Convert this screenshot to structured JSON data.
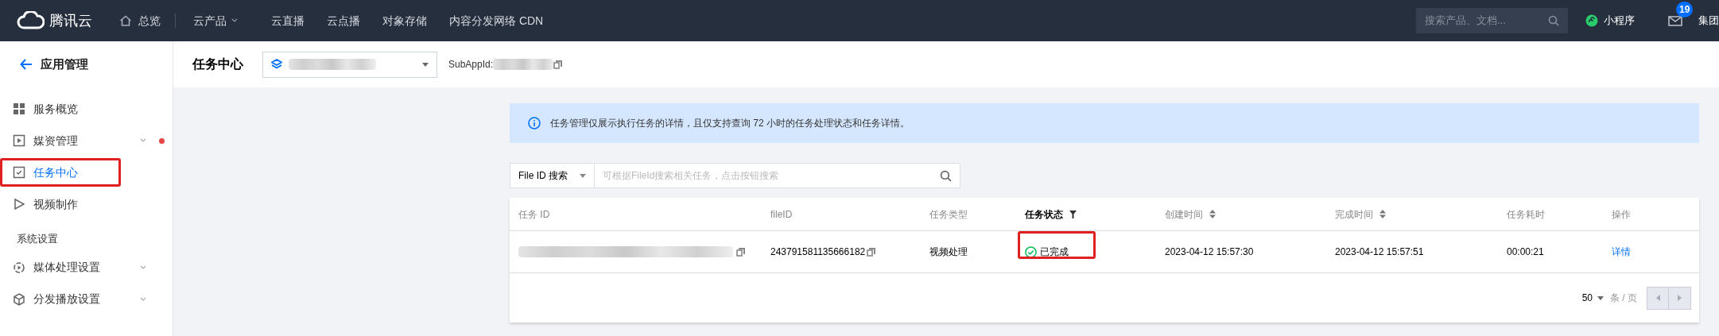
{
  "top_bar": {
    "logo": "腾讯云",
    "nav": [
      {
        "label": "总览",
        "kind": "home"
      },
      {
        "label": "云产品",
        "kind": "dropdown"
      },
      {
        "label": "云直播",
        "kind": "link"
      },
      {
        "label": "云点播",
        "kind": "link"
      },
      {
        "label": "对象存储",
        "kind": "link"
      },
      {
        "label": "内容分发网络 CDN",
        "kind": "link"
      }
    ],
    "search": {
      "placeholder": "搜索产品、文档..."
    },
    "mini_program": "小程序",
    "message_count": "19",
    "account": "集团"
  },
  "sidebar": {
    "back_title": "应用管理",
    "items": [
      {
        "label": "服务概览",
        "kind": "grid",
        "selected": false,
        "expandable": false,
        "dot": false,
        "highlighted": false
      },
      {
        "label": "媒资管理",
        "kind": "media",
        "selected": false,
        "expandable": true,
        "dot": true,
        "highlighted": false
      },
      {
        "label": "任务中心",
        "kind": "task",
        "selected": true,
        "expandable": false,
        "dot": false,
        "highlighted": true
      },
      {
        "label": "视频制作",
        "kind": "play",
        "selected": false,
        "expandable": false,
        "dot": false,
        "highlighted": false
      }
    ],
    "section": "系统设置",
    "settings_items": [
      {
        "label": "媒体处理设置",
        "kind": "process",
        "selected": false,
        "expandable": true,
        "dot": false,
        "highlighted": false
      },
      {
        "label": "分发播放设置",
        "kind": "cube",
        "selected": false,
        "expandable": true,
        "dot": false,
        "highlighted": false
      }
    ]
  },
  "page_header": {
    "title": "任务中心",
    "subappid_label": "SubAppId:"
  },
  "notice": "任务管理仅展示执行任务的详情，且仅支持查询 72 小时的任务处理状态和任务详情。",
  "search": {
    "type_filter": "File ID 搜索",
    "placeholder": "可根据FileId搜索相关任务，点击按钮搜索"
  },
  "table": {
    "columns": [
      {
        "label": "任务 ID",
        "kind": "plain"
      },
      {
        "label": "fileID",
        "kind": "plain"
      },
      {
        "label": "任务类型",
        "kind": "plain"
      },
      {
        "label": "任务状态",
        "kind": "filter"
      },
      {
        "label": "创建时间",
        "kind": "sort"
      },
      {
        "label": "完成时间",
        "kind": "sort"
      },
      {
        "label": "任务耗时",
        "kind": "plain"
      },
      {
        "label": "操作",
        "kind": "plain"
      }
    ],
    "rows": [
      {
        "file_id": "243791581135666182",
        "type": "视频处理",
        "status": "已完成",
        "status_highlighted": true,
        "created": "2023-04-12 15:57:30",
        "finished": "2023-04-12 15:57:51",
        "duration": "00:00:21",
        "action": "详情"
      }
    ]
  },
  "pagination": {
    "page_size": "50",
    "unit": "条 / 页"
  }
}
